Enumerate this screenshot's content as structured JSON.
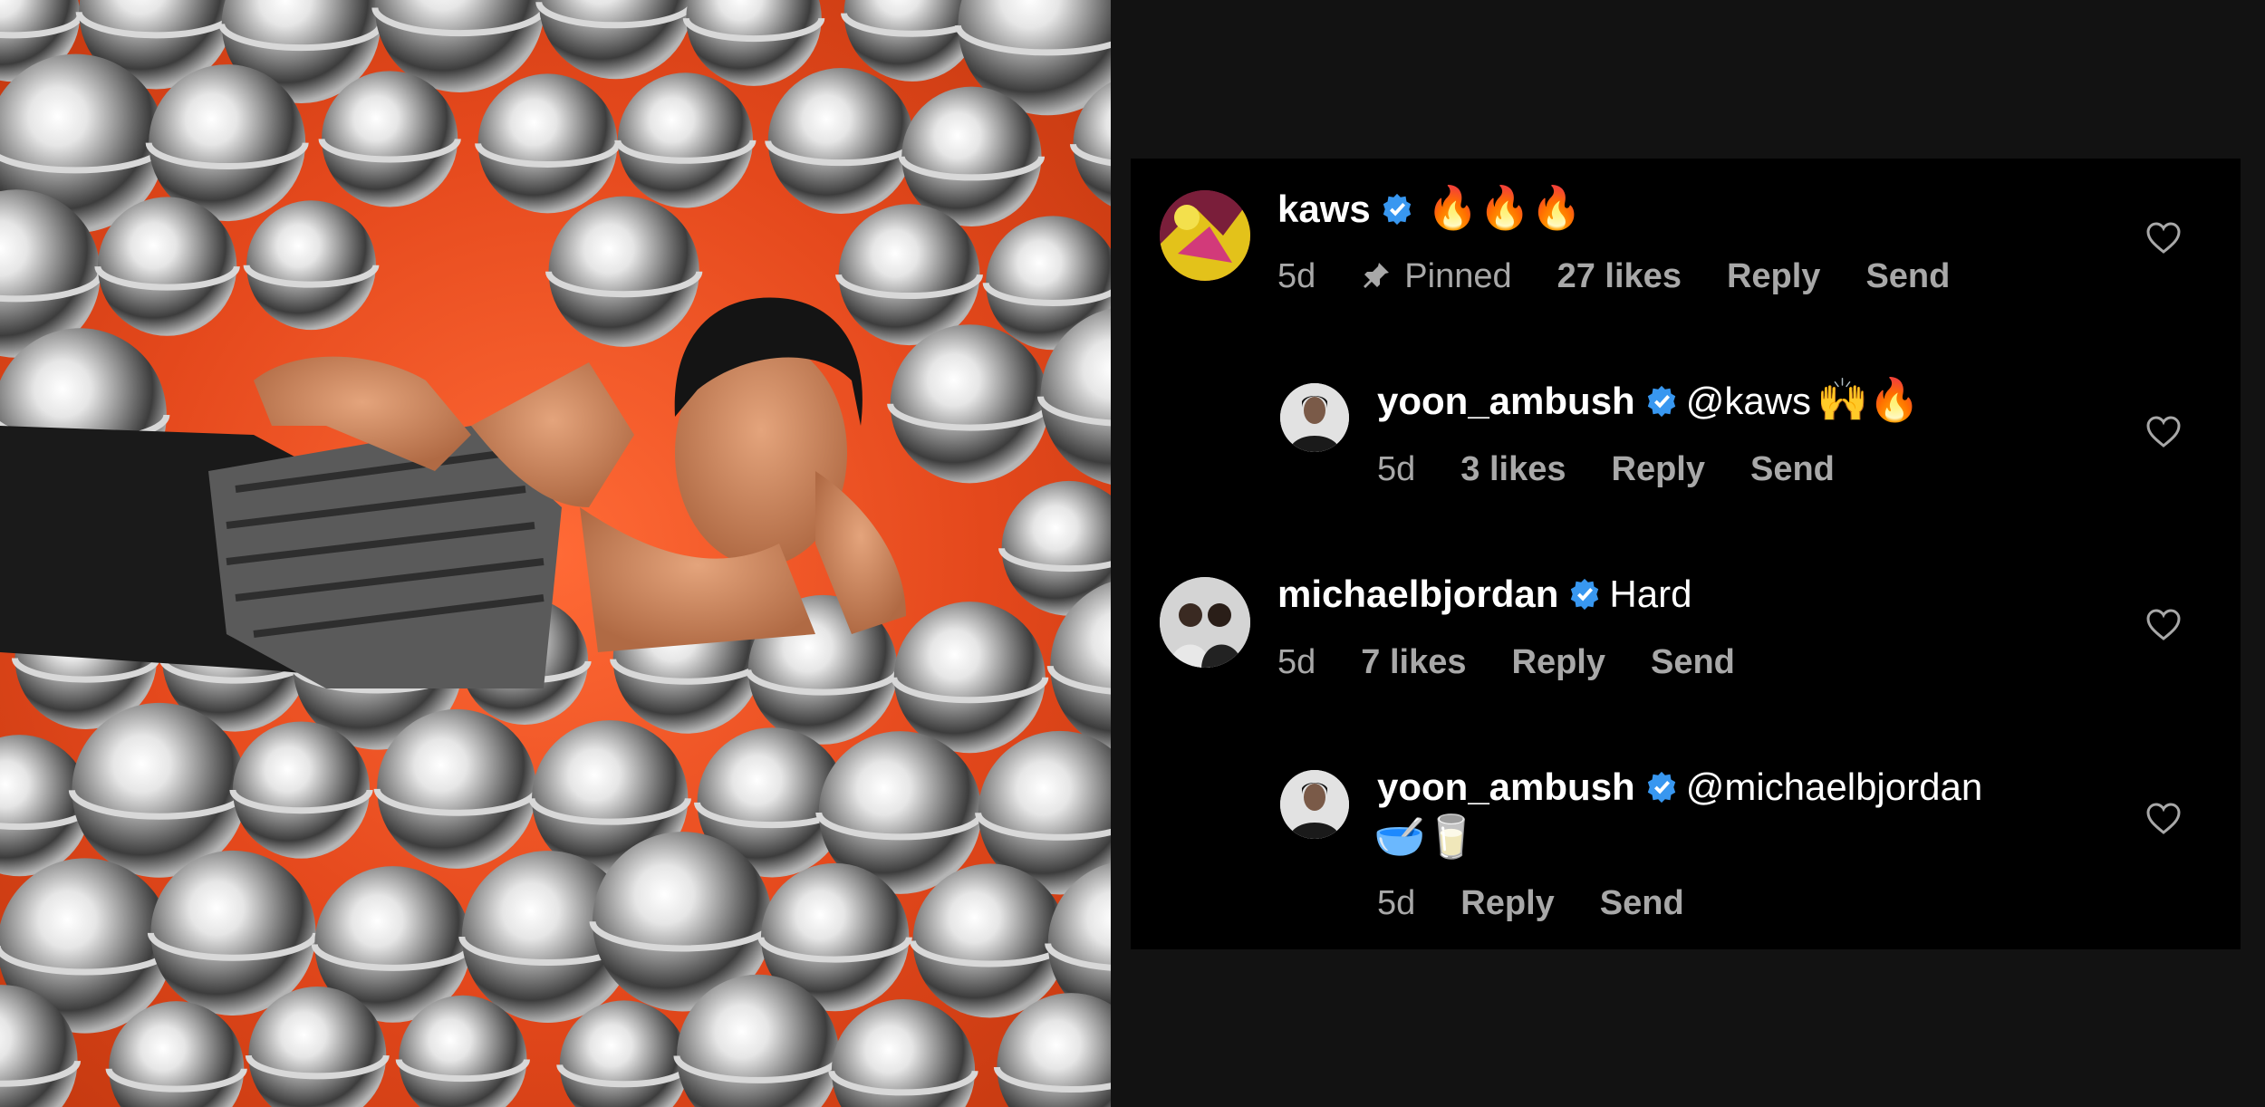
{
  "photo": {
    "description_icon": "photo-image"
  },
  "comments": [
    {
      "username": "kaws",
      "text": "🔥🔥🔥",
      "time": "5d",
      "pinned_label": "Pinned",
      "likes": "27 likes",
      "reply": "Reply",
      "send": "Send"
    },
    {
      "username": "yoon_ambush",
      "mention": "@kaws",
      "text": "🙌🔥",
      "time": "5d",
      "likes": "3 likes",
      "reply": "Reply",
      "send": "Send"
    },
    {
      "username": "michaelbjordan",
      "text": "Hard",
      "time": "5d",
      "likes": "7 likes",
      "reply": "Reply",
      "send": "Send"
    },
    {
      "username": "yoon_ambush",
      "mention": "@michaelbjordan",
      "text": "🥣🥛",
      "time": "5d",
      "reply": "Reply",
      "send": "Send"
    }
  ],
  "colors": {
    "verified": "#3897f0",
    "meta": "#a8a8a8",
    "panel_bg": "#000000",
    "page_bg": "#121212"
  }
}
